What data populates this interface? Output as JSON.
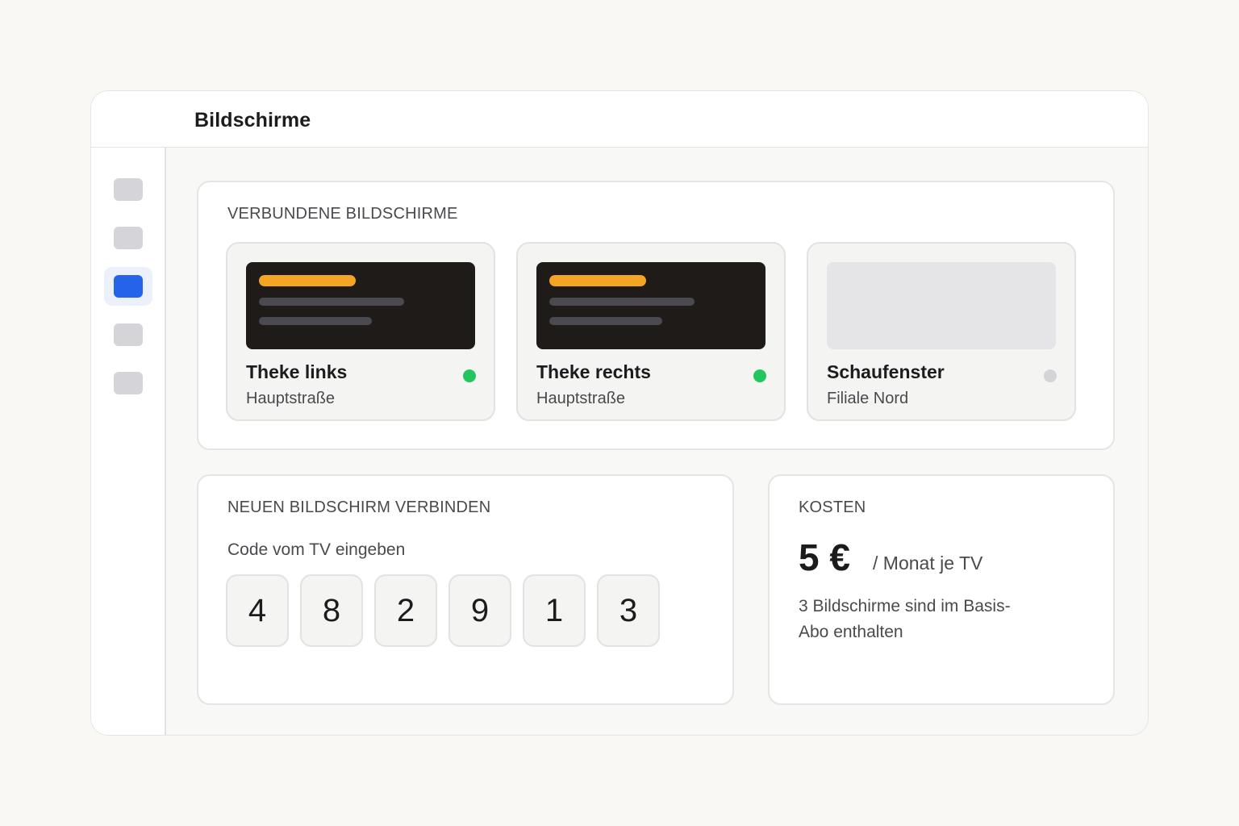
{
  "header": {
    "title": "Bildschirme"
  },
  "sidebar": {
    "items": [
      {
        "name": "nav-item-1",
        "active": false
      },
      {
        "name": "nav-item-2",
        "active": false
      },
      {
        "name": "nav-item-screens",
        "active": true
      },
      {
        "name": "nav-item-4",
        "active": false
      },
      {
        "name": "nav-item-5",
        "active": false
      }
    ]
  },
  "connected": {
    "heading": "VERBUNDENE BILDSCHIRME",
    "screens": [
      {
        "name": "Theke links",
        "location": "Hauptstraße",
        "status": "online"
      },
      {
        "name": "Theke rechts",
        "location": "Hauptstraße",
        "status": "online"
      },
      {
        "name": "Schaufenster",
        "location": "Filiale Nord",
        "status": "offline"
      }
    ]
  },
  "connect": {
    "heading": "NEUEN BILDSCHIRM VERBINDEN",
    "code_label": "Code vom TV eingeben",
    "code": [
      "4",
      "8",
      "2",
      "9",
      "1",
      "3"
    ]
  },
  "costs": {
    "heading": "KOSTEN",
    "price": "5 €",
    "unit": "/ Monat je TV",
    "note": "3 Bildschirme sind im Basis-Abo enthalten"
  },
  "colors": {
    "accent": "#2563eb",
    "online": "#22c55e",
    "offline": "#d4d4d8",
    "preview_highlight": "#f5a524"
  }
}
